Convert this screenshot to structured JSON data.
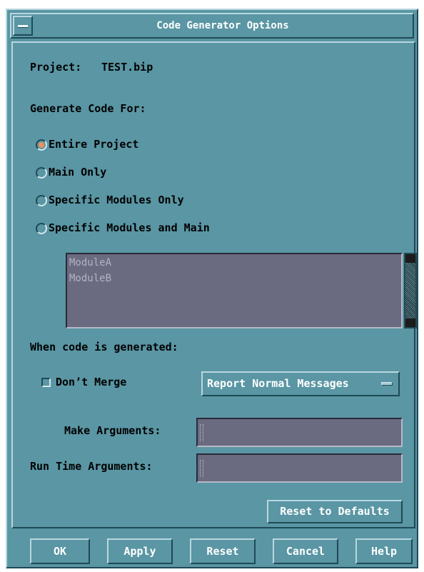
{
  "window": {
    "title": "Code Generator Options"
  },
  "project": {
    "label": "Project:",
    "value": "TEST.bip"
  },
  "generate": {
    "heading": "Generate Code For:",
    "options": [
      {
        "label": "Entire Project",
        "selected": true
      },
      {
        "label": "Main Only",
        "selected": false
      },
      {
        "label": "Specific Modules Only",
        "selected": false
      },
      {
        "label": "Specific Modules and Main",
        "selected": false
      }
    ],
    "modules": [
      "ModuleA",
      "ModuleB"
    ]
  },
  "when": {
    "heading": "When code is generated:",
    "dont_merge": {
      "label": "Don’t Merge",
      "checked": false
    },
    "messages_option": "Report Normal Messages"
  },
  "args": {
    "make_label": "Make Arguments:",
    "make_value": "",
    "run_label": "Run Time Arguments:",
    "run_value": ""
  },
  "reset_defaults_label": "Reset to Defaults",
  "buttons": {
    "ok": "OK",
    "apply": "Apply",
    "reset": "Reset",
    "cancel": "Cancel",
    "help": "Help"
  },
  "colors": {
    "dialog_bg": "#5a96a4",
    "field_bg": "#6a6a80",
    "radio_selected": "#f0905c"
  }
}
